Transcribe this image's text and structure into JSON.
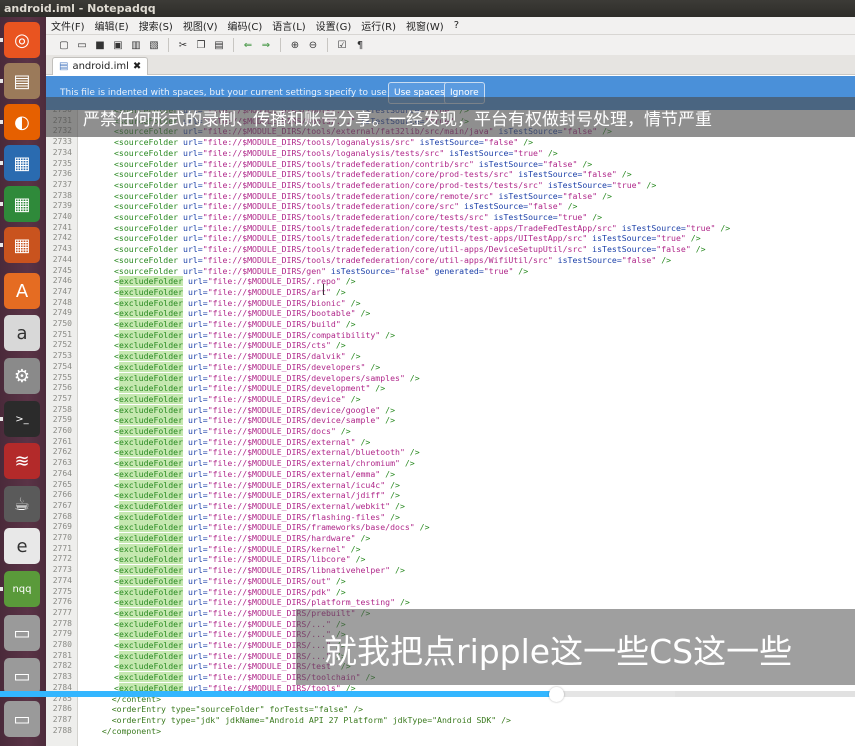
{
  "window": {
    "title": "android.iml - Notepadqq"
  },
  "menubar": [
    "文件(F)",
    "编辑(E)",
    "搜索(S)",
    "视图(V)",
    "编码(C)",
    "语言(L)",
    "设置(G)",
    "运行(R)",
    "视窗(W)",
    "?"
  ],
  "tab": {
    "label": "android.iml",
    "close": "✖"
  },
  "banner": {
    "text": "This file is indented with spaces, but your current settings specify to use tabs.",
    "use_spaces": "Use spaces",
    "ignore": "Ignore"
  },
  "overlay_top": "严禁任何形式的录制、传播和账号分享。一经发现，平台有权做封号处理，情节严重",
  "overlay_bottom": "就我把点ripple这一些CS这一些",
  "progress": {
    "played_fraction": 0.65,
    "buffered_fraction": 0.79
  },
  "launcher": [
    {
      "name": "ubuntu-dash-icon",
      "glyph": "◎",
      "color": "#e95420"
    },
    {
      "name": "files-icon",
      "glyph": "▤",
      "color": "#9b7a5a"
    },
    {
      "name": "firefox-icon",
      "glyph": "◐",
      "color": "#e66000"
    },
    {
      "name": "writer-icon",
      "glyph": "▦",
      "color": "#2a6bb0"
    },
    {
      "name": "calc-icon",
      "glyph": "▦",
      "color": "#2f8a3a"
    },
    {
      "name": "impress-icon",
      "glyph": "▦",
      "color": "#c9531e"
    },
    {
      "name": "software-center-icon",
      "glyph": "A",
      "color": "#e56c22"
    },
    {
      "name": "amazon-icon",
      "glyph": "a",
      "color": "#d8d8d8"
    },
    {
      "name": "settings-icon",
      "glyph": "⚙",
      "color": "#8a8a8a"
    },
    {
      "name": "terminal-icon",
      "glyph": ">_",
      "color": "#2b2b2b"
    },
    {
      "name": "system-monitor-icon",
      "glyph": "≋",
      "color": "#b32a2a"
    },
    {
      "name": "java-icon",
      "glyph": "☕",
      "color": "#5a5a5a"
    },
    {
      "name": "document-viewer-icon",
      "glyph": "e",
      "color": "#e8e8e8"
    },
    {
      "name": "notepadqq-icon",
      "glyph": "nqq",
      "color": "#5a9a3a"
    },
    {
      "name": "drive-icon-1",
      "glyph": "▭",
      "color": "#9a9a9a"
    },
    {
      "name": "drive-icon-2",
      "glyph": "▭",
      "color": "#9a9a9a"
    },
    {
      "name": "drive-icon-3",
      "glyph": "▭",
      "color": "#9a9a9a"
    }
  ],
  "editor": {
    "lines": [
      {
        "n": "2730",
        "kind": "source",
        "path": "$MODULE_DIRS/tools/...",
        "ts": "true",
        "gen": ""
      },
      {
        "n": "2731",
        "kind": "source",
        "path": "$MODULE_DIRS/tools/...",
        "ts": "true",
        "gen": ""
      },
      {
        "n": "2732",
        "kind": "source",
        "path": "$MODULE_DIRS/tools/external/fat32lib/src/main/java",
        "ts": "false",
        "gen": ""
      },
      {
        "n": "2733",
        "kind": "source",
        "path": "$MODULE_DIRS/tools/loganalysis/src",
        "ts": "false",
        "gen": ""
      },
      {
        "n": "2734",
        "kind": "source",
        "path": "$MODULE_DIRS/tools/loganalysis/tests/src",
        "ts": "true",
        "gen": ""
      },
      {
        "n": "2735",
        "kind": "source",
        "path": "$MODULE_DIRS/tools/tradefederation/contrib/src",
        "ts": "false",
        "gen": ""
      },
      {
        "n": "2736",
        "kind": "source",
        "path": "$MODULE_DIRS/tools/tradefederation/core/prod-tests/src",
        "ts": "false",
        "gen": ""
      },
      {
        "n": "2737",
        "kind": "source",
        "path": "$MODULE_DIRS/tools/tradefederation/core/prod-tests/tests/src",
        "ts": "true",
        "gen": ""
      },
      {
        "n": "2738",
        "kind": "source",
        "path": "$MODULE_DIRS/tools/tradefederation/core/remote/src",
        "ts": "false",
        "gen": ""
      },
      {
        "n": "2739",
        "kind": "source",
        "path": "$MODULE_DIRS/tools/tradefederation/core/src",
        "ts": "false",
        "gen": ""
      },
      {
        "n": "2740",
        "kind": "source",
        "path": "$MODULE_DIRS/tools/tradefederation/core/tests/src",
        "ts": "true",
        "gen": ""
      },
      {
        "n": "2741",
        "kind": "source",
        "path": "$MODULE_DIRS/tools/tradefederation/core/tests/test-apps/TradeFedTestApp/src",
        "ts": "true",
        "gen": ""
      },
      {
        "n": "2742",
        "kind": "source",
        "path": "$MODULE_DIRS/tools/tradefederation/core/tests/test-apps/UITestApp/src",
        "ts": "true",
        "gen": ""
      },
      {
        "n": "2743",
        "kind": "source",
        "path": "$MODULE_DIRS/tools/tradefederation/core/util-apps/DeviceSetupUtil/src",
        "ts": "false",
        "gen": ""
      },
      {
        "n": "2744",
        "kind": "source",
        "path": "$MODULE_DIRS/tools/tradefederation/core/util-apps/WifiUtil/src",
        "ts": "false",
        "gen": ""
      },
      {
        "n": "2745",
        "kind": "source",
        "path": "$MODULE_DIRS/gen",
        "ts": "false",
        "gen": "true"
      },
      {
        "n": "2746",
        "kind": "exclude",
        "path": "$MODULE_DIRS/.repo"
      },
      {
        "n": "2747",
        "kind": "exclude",
        "path": "$MODULE_DIRS/art"
      },
      {
        "n": "2748",
        "kind": "exclude",
        "path": "$MODULE_DIRS/bionic"
      },
      {
        "n": "2749",
        "kind": "exclude",
        "path": "$MODULE_DIRS/bootable"
      },
      {
        "n": "2750",
        "kind": "exclude",
        "path": "$MODULE_DIRS/build"
      },
      {
        "n": "2751",
        "kind": "exclude",
        "path": "$MODULE_DIRS/compatibility"
      },
      {
        "n": "2752",
        "kind": "exclude",
        "path": "$MODULE_DIRS/cts"
      },
      {
        "n": "2753",
        "kind": "exclude",
        "path": "$MODULE_DIRS/dalvik"
      },
      {
        "n": "2754",
        "kind": "exclude",
        "path": "$MODULE_DIRS/developers"
      },
      {
        "n": "2755",
        "kind": "exclude",
        "path": "$MODULE_DIRS/developers/samples"
      },
      {
        "n": "2756",
        "kind": "exclude",
        "path": "$MODULE_DIRS/development"
      },
      {
        "n": "2757",
        "kind": "exclude",
        "path": "$MODULE_DIRS/device"
      },
      {
        "n": "2758",
        "kind": "exclude",
        "path": "$MODULE_DIRS/device/google"
      },
      {
        "n": "2759",
        "kind": "exclude",
        "path": "$MODULE_DIRS/device/sample"
      },
      {
        "n": "2760",
        "kind": "exclude",
        "path": "$MODULE_DIRS/docs"
      },
      {
        "n": "2761",
        "kind": "exclude",
        "path": "$MODULE_DIRS/external"
      },
      {
        "n": "2762",
        "kind": "exclude",
        "path": "$MODULE_DIRS/external/bluetooth"
      },
      {
        "n": "2763",
        "kind": "exclude",
        "path": "$MODULE_DIRS/external/chromium"
      },
      {
        "n": "2764",
        "kind": "exclude",
        "path": "$MODULE_DIRS/external/emma"
      },
      {
        "n": "2765",
        "kind": "exclude",
        "path": "$MODULE_DIRS/external/icu4c"
      },
      {
        "n": "2766",
        "kind": "exclude",
        "path": "$MODULE_DIRS/external/jdiff"
      },
      {
        "n": "2767",
        "kind": "exclude",
        "path": "$MODULE_DIRS/external/webkit"
      },
      {
        "n": "2768",
        "kind": "exclude",
        "path": "$MODULE_DIRS/flashing-files"
      },
      {
        "n": "2769",
        "kind": "exclude",
        "path": "$MODULE_DIRS/frameworks/base/docs"
      },
      {
        "n": "2770",
        "kind": "exclude",
        "path": "$MODULE_DIRS/hardware"
      },
      {
        "n": "2771",
        "kind": "exclude",
        "path": "$MODULE_DIRS/kernel"
      },
      {
        "n": "2772",
        "kind": "exclude",
        "path": "$MODULE_DIRS/libcore"
      },
      {
        "n": "2773",
        "kind": "exclude",
        "path": "$MODULE_DIRS/libnativehelper"
      },
      {
        "n": "2774",
        "kind": "exclude",
        "path": "$MODULE_DIRS/out"
      },
      {
        "n": "2775",
        "kind": "exclude",
        "path": "$MODULE_DIRS/pdk"
      },
      {
        "n": "2776",
        "kind": "exclude",
        "path": "$MODULE_DIRS/platform_testing"
      },
      {
        "n": "2777",
        "kind": "exclude",
        "path": "$MODULE_DIRS/prebuilt"
      },
      {
        "n": "2778",
        "kind": "exclude",
        "path": "$MODULE_DIRS/..."
      },
      {
        "n": "2779",
        "kind": "exclude",
        "path": "$MODULE_DIRS/..."
      },
      {
        "n": "2780",
        "kind": "exclude",
        "path": "$MODULE_DIRS/..."
      },
      {
        "n": "2781",
        "kind": "exclude",
        "path": "$MODULE_DIRS/..."
      },
      {
        "n": "2782",
        "kind": "exclude",
        "path": "$MODULE_DIRS/test"
      },
      {
        "n": "2783",
        "kind": "exclude",
        "path": "$MODULE_DIRS/toolchain"
      },
      {
        "n": "2784",
        "kind": "exclude",
        "path": "$MODULE_DIRS/tools"
      },
      {
        "n": "2785",
        "kind": "raw",
        "text": "    </content>"
      },
      {
        "n": "2786",
        "kind": "raw",
        "text": "    <orderEntry type=\"sourceFolder\" forTests=\"false\" />"
      },
      {
        "n": "2787",
        "kind": "raw",
        "text": "    <orderEntry type=\"jdk\" jdkName=\"Android API 27 Platform\" jdkType=\"Android SDK\" />"
      },
      {
        "n": "2788",
        "kind": "raw",
        "text": "  </component>"
      }
    ]
  }
}
